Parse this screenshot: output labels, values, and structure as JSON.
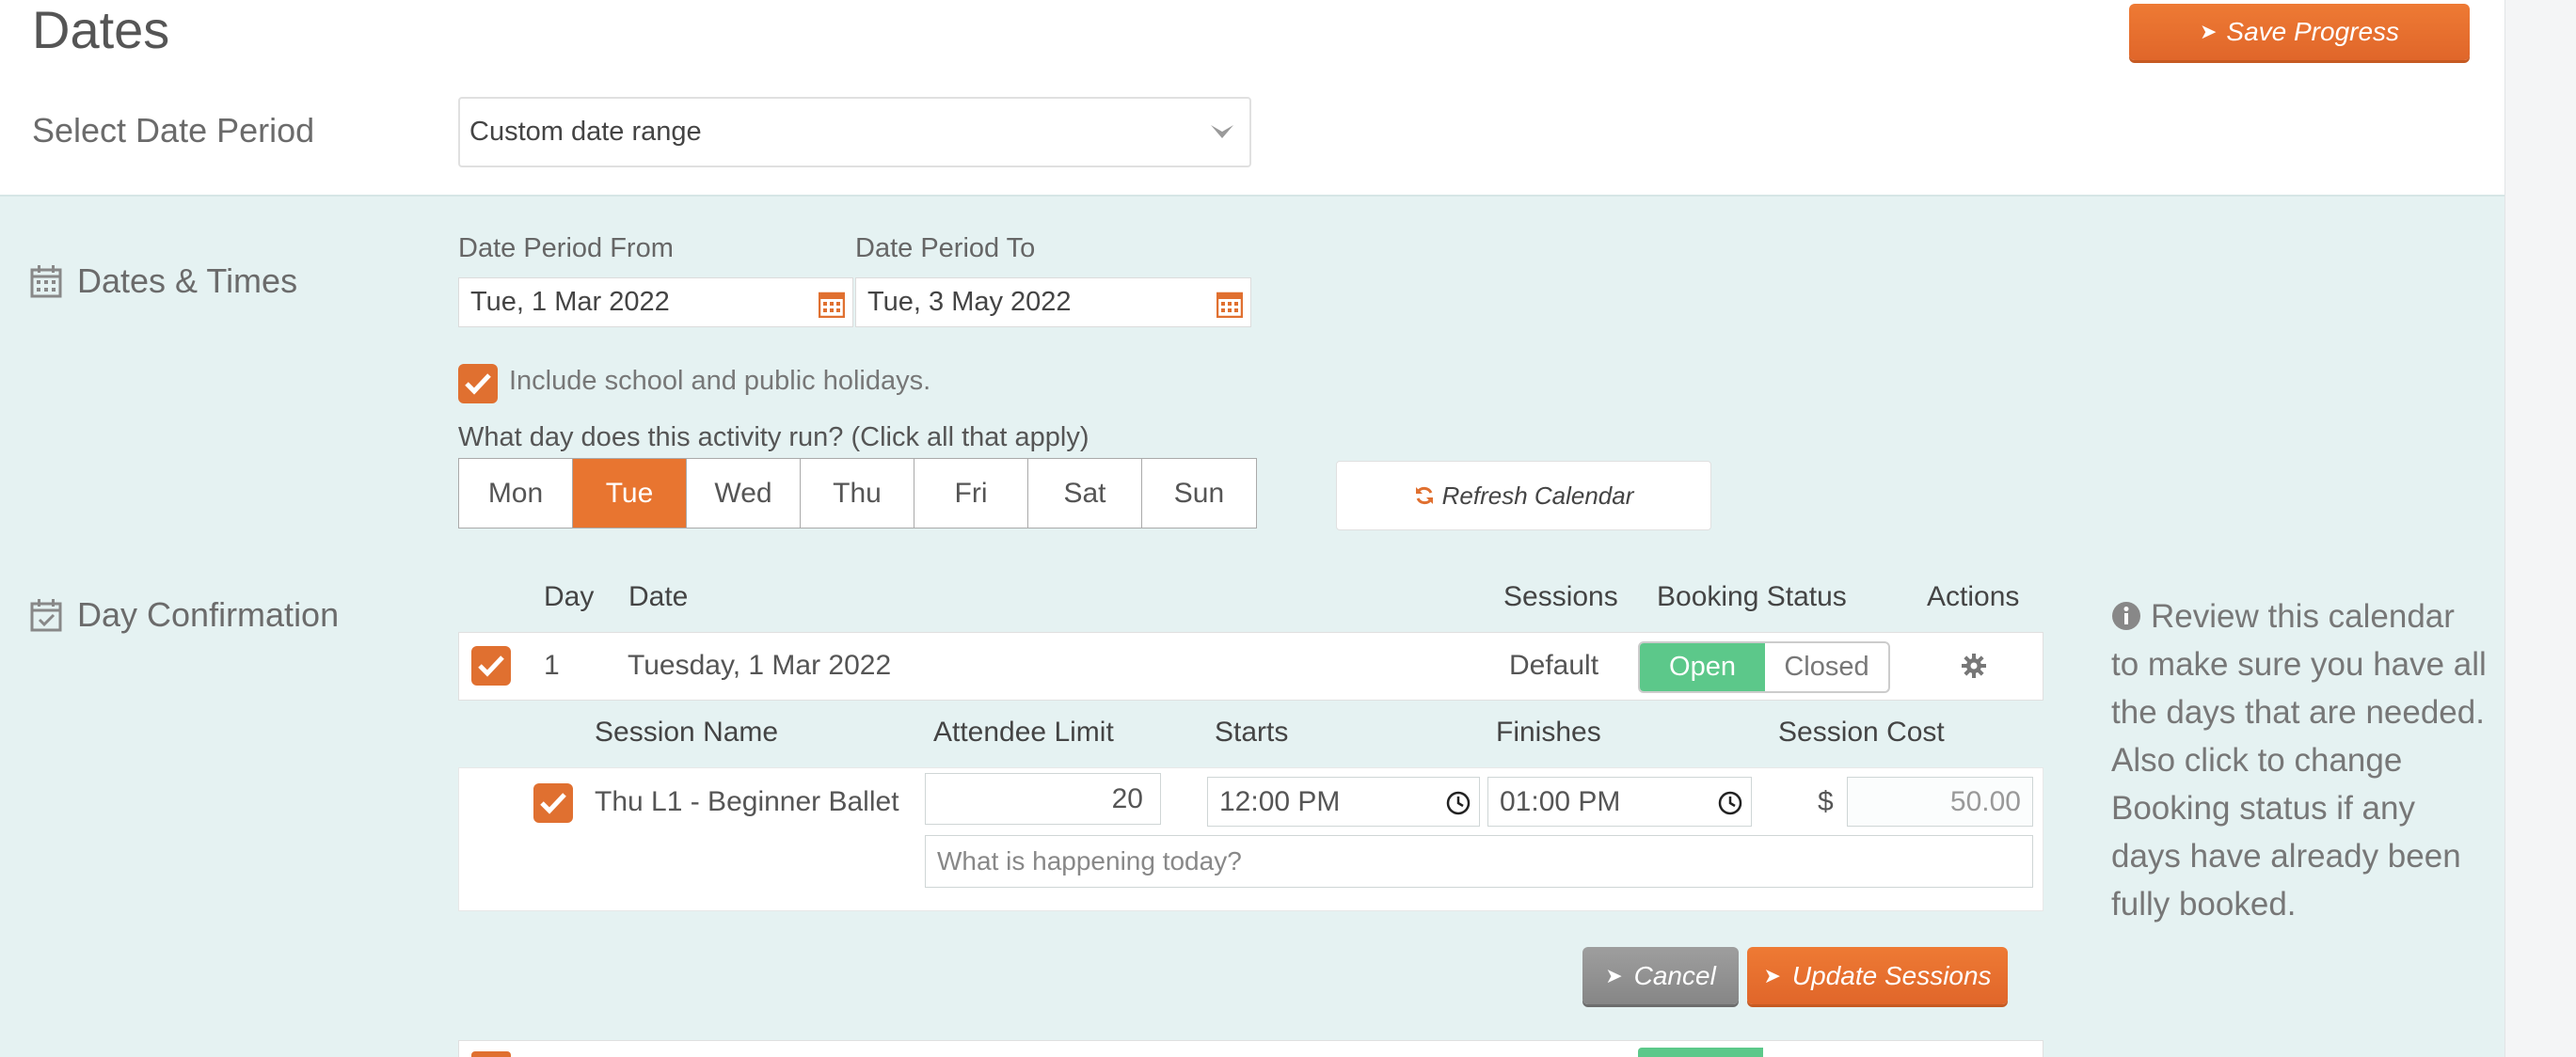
{
  "header": {
    "title": "Dates",
    "save_label": "Save Progress"
  },
  "date_period": {
    "label": "Select Date Period",
    "selected": "Custom date range"
  },
  "dates_times": {
    "section_label": "Dates & Times",
    "from_label": "Date Period From",
    "from_value": "Tue, 1 Mar 2022",
    "to_label": "Date Period To",
    "to_value": "Tue, 3 May 2022",
    "holidays_label": "Include school and public holidays.",
    "question": "What day does this activity run? (Click all that apply)",
    "days": [
      "Mon",
      "Tue",
      "Wed",
      "Thu",
      "Fri",
      "Sat",
      "Sun"
    ],
    "active_day": "Tue",
    "refresh_label": "Refresh Calendar"
  },
  "day_confirmation": {
    "section_label": "Day Confirmation",
    "columns": {
      "day": "Day",
      "date": "Date",
      "sessions": "Sessions",
      "booking_status": "Booking Status",
      "actions": "Actions"
    },
    "rows": [
      {
        "day": "1",
        "date": "Tuesday, 1 Mar 2022",
        "sessions": "Default",
        "status_open": "Open",
        "status_closed": "Closed",
        "selected_status": "Open"
      }
    ],
    "session_columns": {
      "name": "Session Name",
      "attendee_limit": "Attendee Limit",
      "starts": "Starts",
      "finishes": "Finishes",
      "cost": "Session Cost"
    },
    "session": {
      "name": "Thu L1 - Beginner Ballet",
      "attendee_limit": "20",
      "starts": "12:00 PM",
      "finishes": "01:00 PM",
      "currency": "$",
      "cost": "50.00",
      "note_placeholder": "What is happening today?"
    },
    "cancel_label": "Cancel",
    "update_label": "Update Sessions"
  },
  "info_text": "Review this calendar to make sure you have all the days that are needed. Also click to change Booking status if any days have already been fully booked.",
  "colors": {
    "accent": "#e87530",
    "open_green": "#5cc88a",
    "teal_bg": "#e5f2f2"
  }
}
